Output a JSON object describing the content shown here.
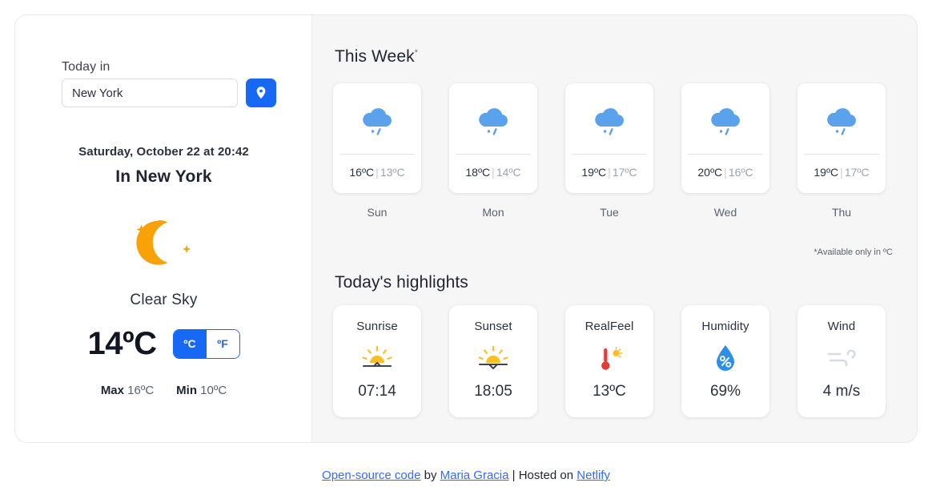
{
  "left": {
    "today_label": "Today in",
    "city_value": "New York",
    "city_placeholder": "New York",
    "geo_button_icon": "location-pin-icon",
    "date_text": "Saturday, October 22 at 20:42",
    "in_city": "In New York",
    "condition_icon": "crescent-moon-icon",
    "condition": "Clear Sky",
    "temperature": "14ºC",
    "unit_celsius": "ºC",
    "unit_fahrenheit": "ºF",
    "active_unit": "ºC",
    "max_label": "Max",
    "max_value": "16ºC",
    "min_label": "Min",
    "min_value": "10ºC"
  },
  "week": {
    "title": "This Week",
    "title_star": "*",
    "note": "*Available only in ºC",
    "separator": "|",
    "days": [
      {
        "name": "Sun",
        "icon": "rain-cloud-icon",
        "high": "16ºC",
        "low": "13ºC"
      },
      {
        "name": "Mon",
        "icon": "rain-cloud-icon",
        "high": "18ºC",
        "low": "14ºC"
      },
      {
        "name": "Tue",
        "icon": "rain-cloud-icon",
        "high": "19ºC",
        "low": "17ºC"
      },
      {
        "name": "Wed",
        "icon": "rain-cloud-icon",
        "high": "20ºC",
        "low": "16ºC"
      },
      {
        "name": "Thu",
        "icon": "rain-cloud-icon",
        "high": "19ºC",
        "low": "17ºC"
      }
    ]
  },
  "highlights": {
    "title": "Today's highlights",
    "items": [
      {
        "label": "Sunrise",
        "icon": "sunrise-icon",
        "value": "07:14"
      },
      {
        "label": "Sunset",
        "icon": "sunset-icon",
        "value": "18:05"
      },
      {
        "label": "RealFeel",
        "icon": "thermometer-icon",
        "value": "13ºC"
      },
      {
        "label": "Humidity",
        "icon": "water-drop-icon",
        "value": "69%"
      },
      {
        "label": "Wind",
        "icon": "wind-icon",
        "value": "4 m/s"
      }
    ]
  },
  "footer": {
    "link_code": "Open-source code",
    "by": " by ",
    "link_author": "Maria Gracia",
    "divider": " | Hosted on ",
    "link_host": "Netlify"
  },
  "colors": {
    "accent_blue": "#1668f5",
    "link_blue": "#2f6df6",
    "moon_orange": "#f9a109",
    "cloud_blue": "#5aa2ec",
    "panel_gray": "#f6f6f7"
  }
}
